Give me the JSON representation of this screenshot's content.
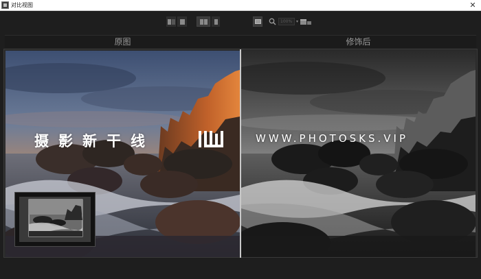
{
  "window": {
    "title": "对比视图",
    "close_glyph": "✕",
    "app_icon": "compare-view-app-icon"
  },
  "toolbar": {
    "view_modes": [
      {
        "name": "side-by-side-view",
        "icon": "split-left-icon",
        "active": false
      },
      {
        "name": "single-view",
        "icon": "single-panel-icon",
        "active": false
      },
      {
        "name": "split-compare-view",
        "icon": "split-active-icon",
        "active": true
      },
      {
        "name": "before-only-view",
        "icon": "single-panel-right-icon",
        "active": false
      }
    ],
    "fit_icon": "fit-screen-icon",
    "search_icon": "zoom-magnifier-icon",
    "zoom_value": "100%",
    "zoom_caret": "▾",
    "window_icon": "window-toggle-icon"
  },
  "panels": {
    "before_label": "原图",
    "after_label": "修饰后"
  },
  "watermark": {
    "chinese": "摄影新干线",
    "english": "WWW.PHOTOSKS.VIP",
    "logo_icon": "photosks-logo-icon"
  },
  "navigator": {
    "icon": "navigator-thumbnail"
  },
  "colors": {
    "background": "#1e1e1e",
    "titlebar": "#ffffff",
    "label_text": "#9a9a9a",
    "divider": "#c9c9c9"
  }
}
